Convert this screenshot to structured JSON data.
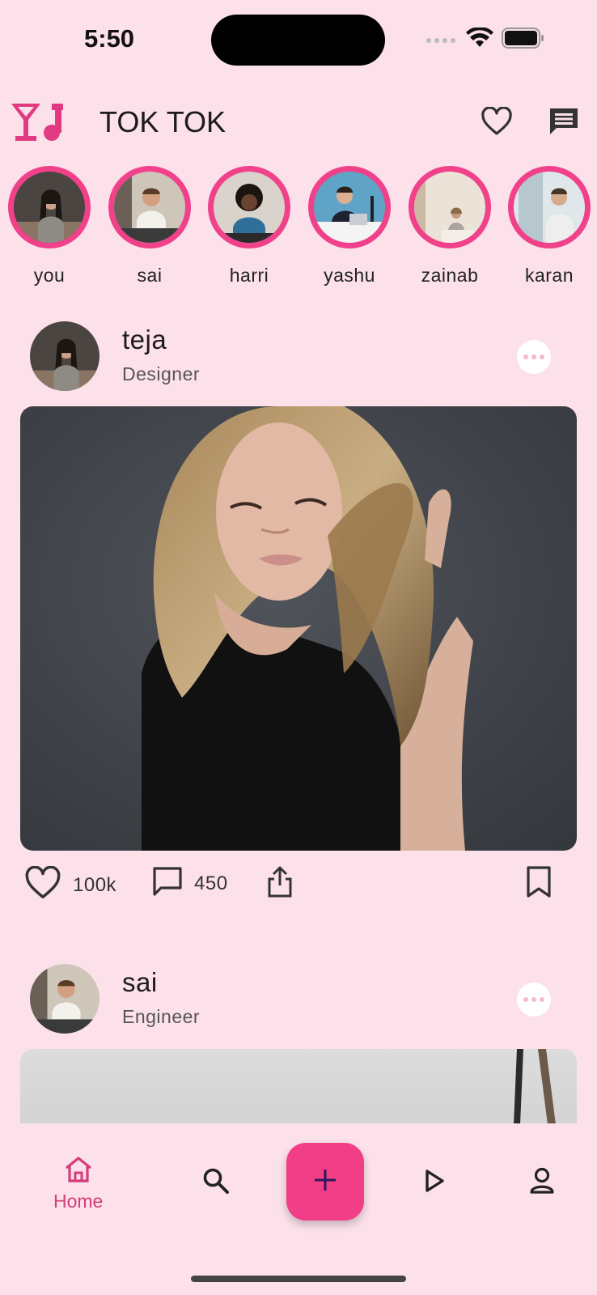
{
  "status": {
    "time": "5:50"
  },
  "header": {
    "title": "TOK TOK"
  },
  "stories": [
    {
      "label": "you"
    },
    {
      "label": "sai"
    },
    {
      "label": "harri"
    },
    {
      "label": "yashu"
    },
    {
      "label": "zainab"
    },
    {
      "label": "karan"
    }
  ],
  "posts": [
    {
      "name": "teja",
      "role": "Designer",
      "likes": "100k",
      "comments": "450"
    },
    {
      "name": "sai",
      "role": "Engineer"
    }
  ],
  "nav": {
    "home_label": "Home",
    "active": "home"
  },
  "colors": {
    "accent": "#f23d87",
    "background": "#fce0ea",
    "nav_active": "#d43d7a"
  },
  "icons": [
    "logo-icon",
    "heart-icon",
    "message-icon",
    "more-icon",
    "comment-icon",
    "share-icon",
    "bookmark-icon",
    "home-icon",
    "search-icon",
    "plus-icon",
    "play-icon",
    "profile-icon"
  ]
}
